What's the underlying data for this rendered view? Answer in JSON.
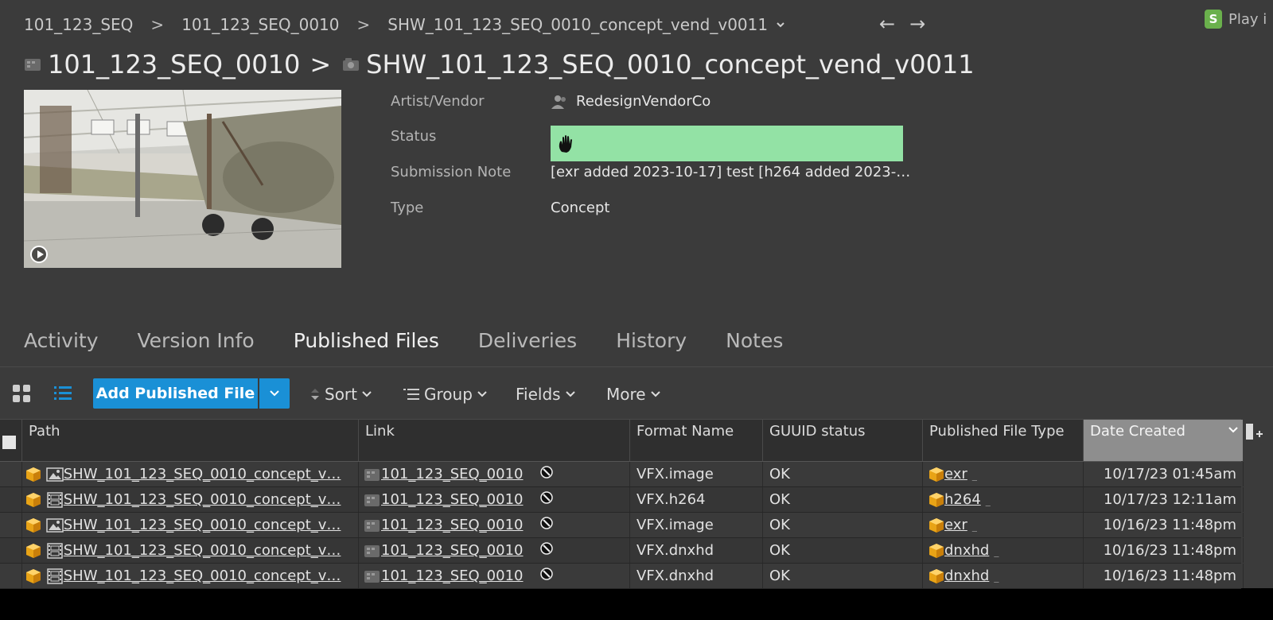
{
  "breadcrumb": {
    "items": [
      "101_123_SEQ",
      "101_123_SEQ_0010",
      "SHW_101_123_SEQ_0010_concept_vend_v0011"
    ],
    "separator": ">"
  },
  "nav": {
    "back": "←",
    "forward": "→"
  },
  "play_in": {
    "icon_text": "S",
    "label": "Play i"
  },
  "title": {
    "parent": "101_123_SEQ_0010",
    "separator": ">",
    "name": "SHW_101_123_SEQ_0010_concept_vend_v0011"
  },
  "fields": {
    "artist_label": "Artist/Vendor",
    "artist_value": "RedesignVendorCo",
    "status_label": "Status",
    "status_color": "#93e2a5",
    "status_icon": "hand-stop-icon",
    "note_label": "Submission Note",
    "note_value": "[exr added 2023-10-17] test [h264 added 2023-…",
    "type_label": "Type",
    "type_value": "Concept"
  },
  "tabs": [
    {
      "label": "Activity",
      "active": false
    },
    {
      "label": "Version Info",
      "active": false
    },
    {
      "label": "Published Files",
      "active": true
    },
    {
      "label": "Deliveries",
      "active": false
    },
    {
      "label": "History",
      "active": false
    },
    {
      "label": "Notes",
      "active": false
    }
  ],
  "toolbar": {
    "add_label": "Add Published File",
    "sort_label": "Sort",
    "group_label": "Group",
    "fields_label": "Fields",
    "more_label": "More",
    "accent": "#1a90d6"
  },
  "table": {
    "columns": [
      "Path",
      "Link",
      "Format Name",
      "GUUID status",
      "Published File Type",
      "Date Created"
    ],
    "sorted_column": "Date Created",
    "rows": [
      {
        "path": "SHW_101_123_SEQ_0010_concept_v…",
        "path_icon": "image-icon",
        "link": "101_123_SEQ_0010",
        "format": "VFX.image",
        "guuid": "OK",
        "type": "exr",
        "date": "10/17/23 01:45am"
      },
      {
        "path": "SHW_101_123_SEQ_0010_concept_v…",
        "path_icon": "film-icon",
        "link": "101_123_SEQ_0010",
        "format": "VFX.h264",
        "guuid": "OK",
        "type": "h264",
        "date": "10/17/23 12:11am"
      },
      {
        "path": "SHW_101_123_SEQ_0010_concept_v…",
        "path_icon": "image-icon",
        "link": "101_123_SEQ_0010",
        "format": "VFX.image",
        "guuid": "OK",
        "type": "exr",
        "date": "10/16/23 11:48pm"
      },
      {
        "path": "SHW_101_123_SEQ_0010_concept_v…",
        "path_icon": "film-icon",
        "link": "101_123_SEQ_0010",
        "format": "VFX.dnxhd",
        "guuid": "OK",
        "type": "dnxhd",
        "date": "10/16/23 11:48pm"
      },
      {
        "path": "SHW_101_123_SEQ_0010_concept_v…",
        "path_icon": "film-icon",
        "link": "101_123_SEQ_0010",
        "format": "VFX.dnxhd",
        "guuid": "OK",
        "type": "dnxhd",
        "date": "10/16/23 11:48pm"
      }
    ]
  }
}
